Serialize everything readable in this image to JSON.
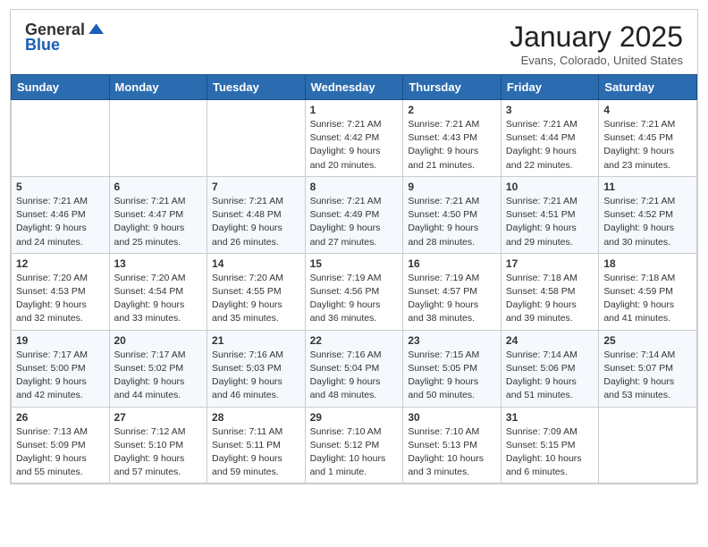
{
  "header": {
    "logo_general": "General",
    "logo_blue": "Blue",
    "month_title": "January 2025",
    "subtitle": "Evans, Colorado, United States"
  },
  "weekdays": [
    "Sunday",
    "Monday",
    "Tuesday",
    "Wednesday",
    "Thursday",
    "Friday",
    "Saturday"
  ],
  "weeks": [
    [
      {
        "day": "",
        "info": ""
      },
      {
        "day": "",
        "info": ""
      },
      {
        "day": "",
        "info": ""
      },
      {
        "day": "1",
        "info": "Sunrise: 7:21 AM\nSunset: 4:42 PM\nDaylight: 9 hours\nand 20 minutes."
      },
      {
        "day": "2",
        "info": "Sunrise: 7:21 AM\nSunset: 4:43 PM\nDaylight: 9 hours\nand 21 minutes."
      },
      {
        "day": "3",
        "info": "Sunrise: 7:21 AM\nSunset: 4:44 PM\nDaylight: 9 hours\nand 22 minutes."
      },
      {
        "day": "4",
        "info": "Sunrise: 7:21 AM\nSunset: 4:45 PM\nDaylight: 9 hours\nand 23 minutes."
      }
    ],
    [
      {
        "day": "5",
        "info": "Sunrise: 7:21 AM\nSunset: 4:46 PM\nDaylight: 9 hours\nand 24 minutes."
      },
      {
        "day": "6",
        "info": "Sunrise: 7:21 AM\nSunset: 4:47 PM\nDaylight: 9 hours\nand 25 minutes."
      },
      {
        "day": "7",
        "info": "Sunrise: 7:21 AM\nSunset: 4:48 PM\nDaylight: 9 hours\nand 26 minutes."
      },
      {
        "day": "8",
        "info": "Sunrise: 7:21 AM\nSunset: 4:49 PM\nDaylight: 9 hours\nand 27 minutes."
      },
      {
        "day": "9",
        "info": "Sunrise: 7:21 AM\nSunset: 4:50 PM\nDaylight: 9 hours\nand 28 minutes."
      },
      {
        "day": "10",
        "info": "Sunrise: 7:21 AM\nSunset: 4:51 PM\nDaylight: 9 hours\nand 29 minutes."
      },
      {
        "day": "11",
        "info": "Sunrise: 7:21 AM\nSunset: 4:52 PM\nDaylight: 9 hours\nand 30 minutes."
      }
    ],
    [
      {
        "day": "12",
        "info": "Sunrise: 7:20 AM\nSunset: 4:53 PM\nDaylight: 9 hours\nand 32 minutes."
      },
      {
        "day": "13",
        "info": "Sunrise: 7:20 AM\nSunset: 4:54 PM\nDaylight: 9 hours\nand 33 minutes."
      },
      {
        "day": "14",
        "info": "Sunrise: 7:20 AM\nSunset: 4:55 PM\nDaylight: 9 hours\nand 35 minutes."
      },
      {
        "day": "15",
        "info": "Sunrise: 7:19 AM\nSunset: 4:56 PM\nDaylight: 9 hours\nand 36 minutes."
      },
      {
        "day": "16",
        "info": "Sunrise: 7:19 AM\nSunset: 4:57 PM\nDaylight: 9 hours\nand 38 minutes."
      },
      {
        "day": "17",
        "info": "Sunrise: 7:18 AM\nSunset: 4:58 PM\nDaylight: 9 hours\nand 39 minutes."
      },
      {
        "day": "18",
        "info": "Sunrise: 7:18 AM\nSunset: 4:59 PM\nDaylight: 9 hours\nand 41 minutes."
      }
    ],
    [
      {
        "day": "19",
        "info": "Sunrise: 7:17 AM\nSunset: 5:00 PM\nDaylight: 9 hours\nand 42 minutes."
      },
      {
        "day": "20",
        "info": "Sunrise: 7:17 AM\nSunset: 5:02 PM\nDaylight: 9 hours\nand 44 minutes."
      },
      {
        "day": "21",
        "info": "Sunrise: 7:16 AM\nSunset: 5:03 PM\nDaylight: 9 hours\nand 46 minutes."
      },
      {
        "day": "22",
        "info": "Sunrise: 7:16 AM\nSunset: 5:04 PM\nDaylight: 9 hours\nand 48 minutes."
      },
      {
        "day": "23",
        "info": "Sunrise: 7:15 AM\nSunset: 5:05 PM\nDaylight: 9 hours\nand 50 minutes."
      },
      {
        "day": "24",
        "info": "Sunrise: 7:14 AM\nSunset: 5:06 PM\nDaylight: 9 hours\nand 51 minutes."
      },
      {
        "day": "25",
        "info": "Sunrise: 7:14 AM\nSunset: 5:07 PM\nDaylight: 9 hours\nand 53 minutes."
      }
    ],
    [
      {
        "day": "26",
        "info": "Sunrise: 7:13 AM\nSunset: 5:09 PM\nDaylight: 9 hours\nand 55 minutes."
      },
      {
        "day": "27",
        "info": "Sunrise: 7:12 AM\nSunset: 5:10 PM\nDaylight: 9 hours\nand 57 minutes."
      },
      {
        "day": "28",
        "info": "Sunrise: 7:11 AM\nSunset: 5:11 PM\nDaylight: 9 hours\nand 59 minutes."
      },
      {
        "day": "29",
        "info": "Sunrise: 7:10 AM\nSunset: 5:12 PM\nDaylight: 10 hours\nand 1 minute."
      },
      {
        "day": "30",
        "info": "Sunrise: 7:10 AM\nSunset: 5:13 PM\nDaylight: 10 hours\nand 3 minutes."
      },
      {
        "day": "31",
        "info": "Sunrise: 7:09 AM\nSunset: 5:15 PM\nDaylight: 10 hours\nand 6 minutes."
      },
      {
        "day": "",
        "info": ""
      }
    ]
  ]
}
